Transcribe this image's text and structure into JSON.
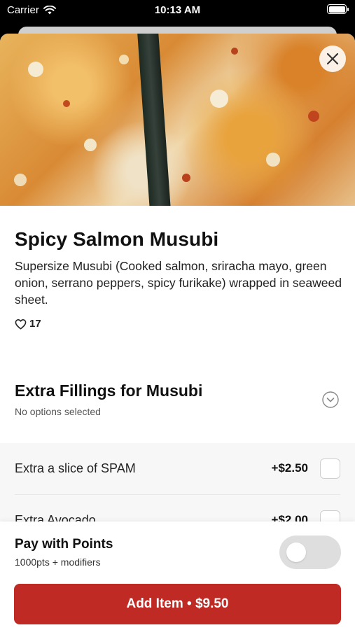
{
  "status_bar": {
    "carrier": "Carrier",
    "time": "10:13 AM"
  },
  "item": {
    "title": "Spicy Salmon Musubi",
    "description": "Supersize Musubi (Cooked salmon, sriracha mayo, green onion, serrano peppers, spicy furikake) wrapped in seaweed sheet.",
    "likes": "17"
  },
  "fillings": {
    "title": "Extra Fillings for Musubi",
    "subtitle": "No options selected",
    "options": [
      {
        "label": "Extra a slice of SPAM",
        "price": "+$2.50",
        "checked": false
      },
      {
        "label": "Extra Avocado",
        "price": "+$2.00",
        "checked": false
      }
    ]
  },
  "points": {
    "title": "Pay with Points",
    "subtitle": "1000pts + modifiers",
    "enabled": false
  },
  "add_button": {
    "label": "Add Item • $9.50"
  },
  "colors": {
    "accent": "#bf2a25",
    "toggle_off": "#dedede"
  }
}
